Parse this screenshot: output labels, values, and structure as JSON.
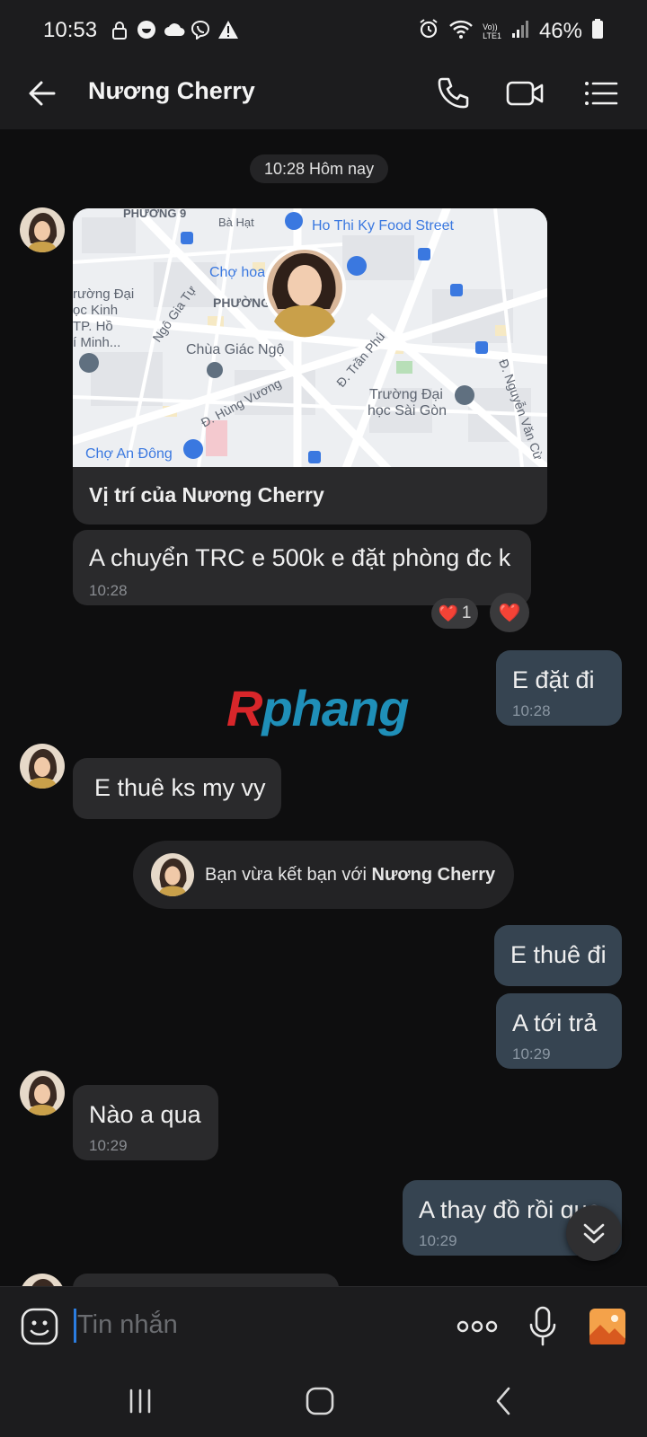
{
  "status_bar": {
    "time": "10:53",
    "battery_percent": "46%",
    "network_label": "LTE1"
  },
  "header": {
    "title": "Nương Cherry"
  },
  "chat": {
    "date_divider": "10:28 Hôm nay",
    "location_card": {
      "caption": "Vị trí của Nương Cherry",
      "map_labels": [
        "PHƯỜNG 9",
        "Bà Hạt",
        "Ho Thi Ky Food Street",
        "Chợ hoa",
        "Trường Đại học Kinh tế TP. Hồ Chí Minh",
        "Ngô Gia Tự",
        "PHƯỜNG",
        "Chùa Giác Ngộ",
        "Đ. Trần Phú",
        "Đ. Hùng Vương",
        "Trường Đại học Sài Gòn",
        "Đ. Nguyễn Văn Cừ",
        "Chợ An Đông"
      ]
    },
    "messages": [
      {
        "side": "in",
        "text": "A chuyển TRC e 500k e đặt phòng đc k",
        "time": "10:28"
      },
      {
        "side": "out",
        "text": "E đặt đi",
        "time": "10:28"
      },
      {
        "side": "in",
        "text": "E thuê ks my vy",
        "time": ""
      },
      {
        "side": "out",
        "text": "E thuê đi",
        "time": ""
      },
      {
        "side": "out",
        "text": "A tới trả",
        "time": "10:29"
      },
      {
        "side": "in",
        "text": "Nào a qua",
        "time": "10:29"
      },
      {
        "side": "out",
        "text": "A thay đồ rồi qua",
        "time": "10:29"
      }
    ],
    "reaction": {
      "emoji": "❤️",
      "count": "1",
      "my_reaction": "❤️"
    },
    "watermark": "Rphang",
    "system_message": {
      "prefix": "Bạn vừa kết bạn với ",
      "name": "Nương Cherry"
    }
  },
  "input": {
    "placeholder": "Tin nhắn"
  },
  "colors": {
    "background": "#0e0e0f",
    "incoming_bubble": "#2a2a2c",
    "outgoing_bubble": "#364451",
    "accent": "#2b7de0",
    "image_icon": "#f4a24a"
  },
  "icons": [
    "back-arrow-icon",
    "phone-icon",
    "video-call-icon",
    "menu-list-icon",
    "sticker-icon",
    "more-dots-icon",
    "microphone-icon",
    "image-gallery-icon",
    "chevrons-down-icon",
    "recents-icon",
    "home-icon",
    "back-nav-icon"
  ]
}
